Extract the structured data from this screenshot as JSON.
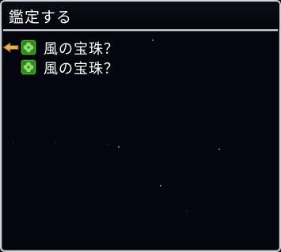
{
  "window": {
    "title": "鑑定する"
  },
  "items": [
    {
      "label": "風の宝珠？",
      "icon": "green-clover-icon",
      "selected": true
    },
    {
      "label": "風の宝珠？",
      "icon": "green-clover-icon",
      "selected": false
    }
  ],
  "colors": {
    "window_background": "#05050f",
    "border": "#cfd3d8",
    "text": "#ffffff",
    "icon_green": "#2e8a1e",
    "cursor": "#e2b04a"
  }
}
